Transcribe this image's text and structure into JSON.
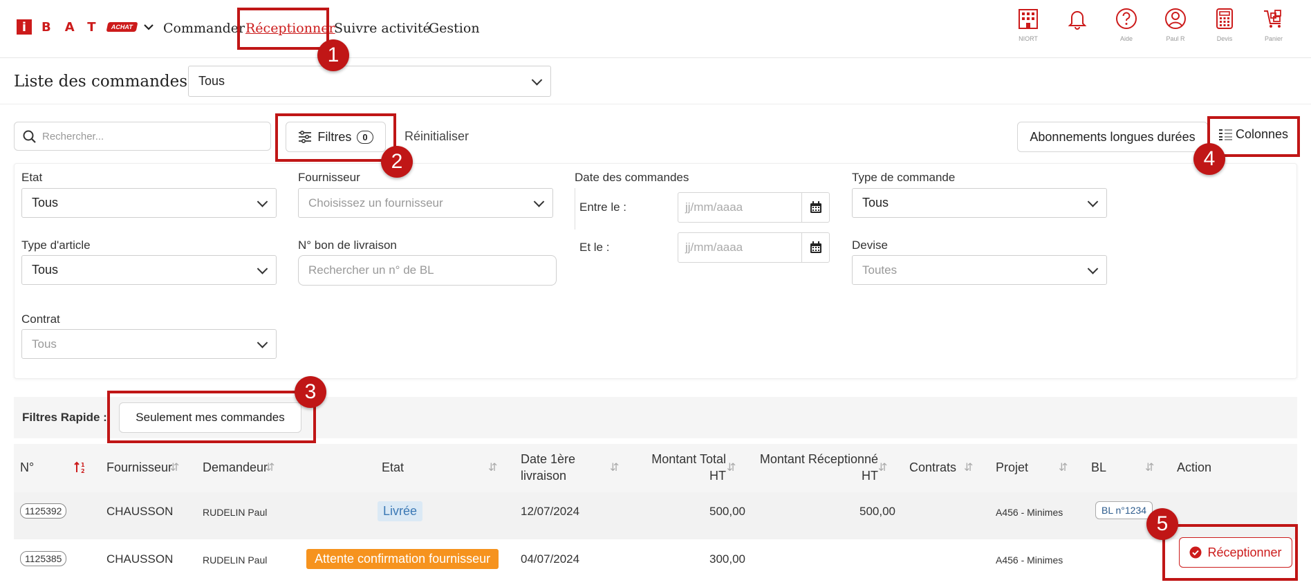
{
  "header": {
    "logo_letter": "i",
    "logo_text": "BAT",
    "logo_badge": "ACHAT",
    "nav": [
      "Commander",
      "Réceptionner",
      "Suivre activité",
      "Gestion"
    ],
    "icons": [
      {
        "name": "building-icon",
        "label": "NIORT"
      },
      {
        "name": "bell-icon",
        "label": ""
      },
      {
        "name": "help-icon",
        "label": "Aide"
      },
      {
        "name": "user-icon",
        "label": "Paul R"
      },
      {
        "name": "calculator-icon",
        "label": "Devis"
      },
      {
        "name": "cart-icon",
        "label": "Panier"
      }
    ],
    "accent_color": "#cc1b1b"
  },
  "page": {
    "title": "Liste des commandes",
    "list_select": "Tous"
  },
  "toolbar": {
    "search_placeholder": "Rechercher...",
    "filters_label": "Filtres",
    "filters_count": "0",
    "reset_label": "Réinitialiser",
    "subscriptions_label": "Abonnements longues durées",
    "columns_label": "Colonnes"
  },
  "filters": {
    "etat_label": "Etat",
    "etat_value": "Tous",
    "fournisseur_label": "Fournisseur",
    "fournisseur_placeholder": "Choisissez un fournisseur",
    "date_label": "Date des commandes",
    "date_from_label": "Entre le :",
    "date_to_label": "Et le :",
    "date_placeholder": "jj/mm/aaaa",
    "type_commande_label": "Type de commande",
    "type_commande_value": "Tous",
    "type_article_label": "Type d'article",
    "type_article_value": "Tous",
    "bl_label": "N° bon de livraison",
    "bl_placeholder": "Rechercher un n° de BL",
    "devise_label": "Devise",
    "devise_value": "Toutes",
    "contrat_label": "Contrat",
    "contrat_value": "Tous"
  },
  "quick_filters": {
    "label": "Filtres Rapide :",
    "mine_label": "Seulement mes commandes"
  },
  "table": {
    "headers": {
      "num": "N°",
      "fournisseur": "Fournisseur",
      "demandeur": "Demandeur",
      "etat": "Etat",
      "date_l1": "Date 1ère",
      "date_l2": "livraison",
      "total_l1": "Montant Total",
      "total_l2": "HT",
      "recv_l1": "Montant Réceptionné",
      "recv_l2": "HT",
      "contrats": "Contrats",
      "projet": "Projet",
      "bl": "BL",
      "action": "Action"
    },
    "rows": [
      {
        "num": "1125392",
        "fournisseur": "CHAUSSON",
        "demandeur": "RUDELIN Paul",
        "etat": "Livrée",
        "date": "12/07/2024",
        "total": "500,00",
        "recu": "500,00",
        "projet": "A456 - Minimes",
        "bl": "BL n°1234"
      },
      {
        "num": "1125385",
        "fournisseur": "CHAUSSON",
        "demandeur": "RUDELIN Paul",
        "etat": "Attente confirmation fournisseur",
        "date": "04/07/2024",
        "total": "300,00",
        "recu": "",
        "projet": "A456 - Minimes",
        "bl": "",
        "action": "Réceptionner"
      }
    ]
  },
  "annotations": [
    "1",
    "2",
    "3",
    "4",
    "5"
  ]
}
